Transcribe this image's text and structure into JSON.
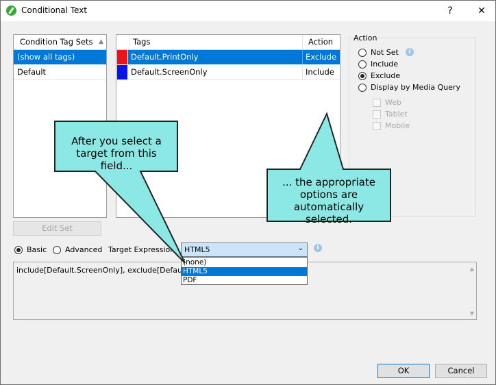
{
  "window": {
    "title": "Conditional Text",
    "help_label": "?",
    "close_label": "✕"
  },
  "condition_tag_sets": {
    "header": "Condition Tag Sets",
    "sort_label": "▲",
    "items": [
      {
        "label": "(show all tags)",
        "selected": true
      },
      {
        "label": "Default",
        "selected": false
      }
    ]
  },
  "tags_table": {
    "columns": [
      "Tags",
      "Action"
    ],
    "rows": [
      {
        "color": "#e8151b",
        "tag": "Default.PrintOnly",
        "action": "Exclude",
        "selected": true
      },
      {
        "color": "#0a16e5",
        "tag": "Default.ScreenOnly",
        "action": "Include",
        "selected": false
      }
    ]
  },
  "action_group": {
    "title": "Action",
    "options": [
      {
        "label": "Not Set",
        "checked": false
      },
      {
        "label": "Include",
        "checked": false
      },
      {
        "label": "Exclude",
        "checked": true
      },
      {
        "label": "Display by Media Query",
        "checked": false
      }
    ],
    "media": [
      "Web",
      "Tablet",
      "Mobile"
    ]
  },
  "edit_set_label": "Edit Set",
  "mode": {
    "basic_label": "Basic",
    "advanced_label": "Advanced",
    "basic_checked": true
  },
  "target_expression": {
    "label": "Target Expression",
    "value": "HTML5",
    "options": [
      "(none)",
      "HTML5",
      "PDF"
    ],
    "selected_index": 1
  },
  "expression_text": "include[Default.ScreenOnly], exclude[Default.Print",
  "callouts": {
    "left": "After you select a target from this field...",
    "right": "... the appropriate options are automatically selected."
  },
  "buttons": {
    "ok": "OK",
    "cancel": "Cancel"
  },
  "colors": {
    "selection": "#0078d7",
    "callout_fill": "#8ce8e4",
    "combo_fill": "#cce4f7"
  }
}
